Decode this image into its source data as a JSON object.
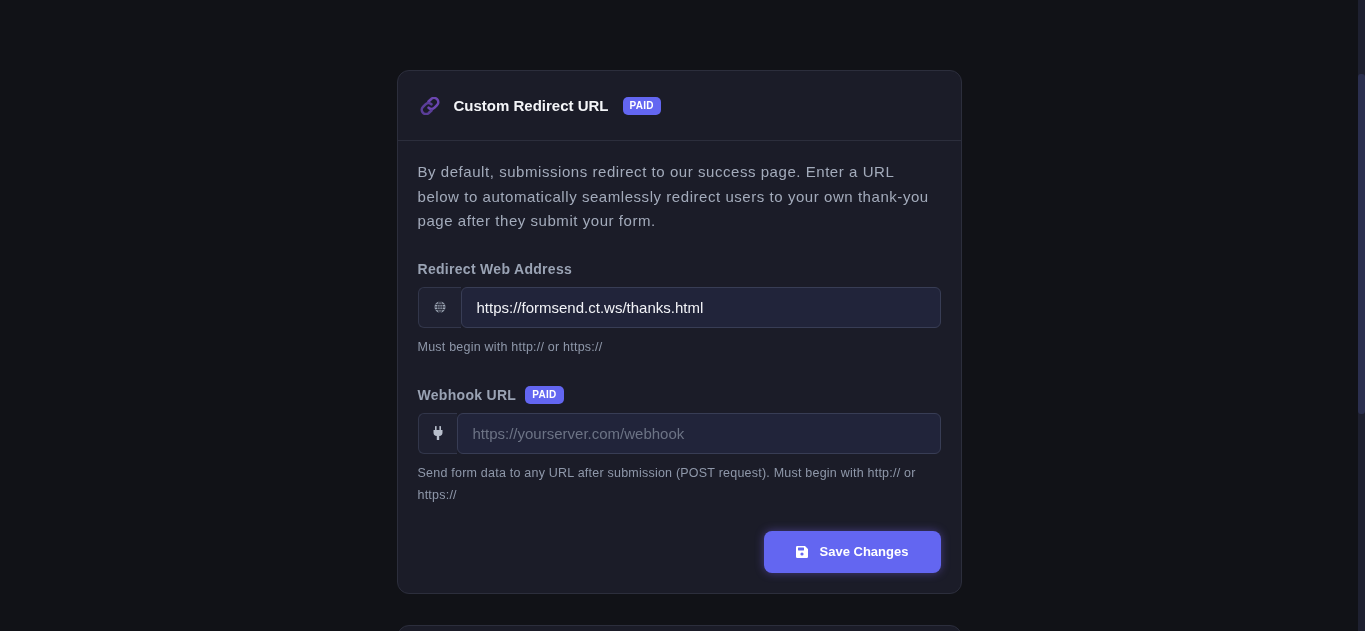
{
  "card": {
    "title": "Custom Redirect URL",
    "badge": "PAID",
    "description": "By default, submissions redirect to our success page. Enter a URL below to automatically seamlessly redirect users to your own thank-you page after they submit your form.",
    "fields": [
      {
        "kind": "address",
        "label": "Redirect Web Address",
        "value": "https://formsend.ct.ws/thanks.html",
        "hint": "Must begin with http:// or https://"
      },
      {
        "kind": "webhook",
        "label": "Webhook URL",
        "badge": "PAID",
        "placeholder": "https://yourserver.com/webhook",
        "hint": "Send form data to any URL after submission (POST request). Must begin with http:// or https://"
      }
    ],
    "save_button": {
      "label": "Save Changes"
    }
  }
}
